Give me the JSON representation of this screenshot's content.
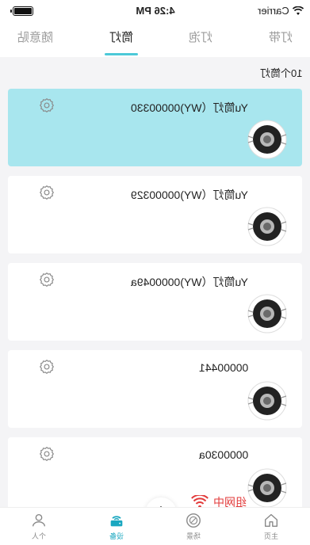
{
  "status_bar": {
    "carrier": "Carrier",
    "time": "4:26 PM",
    "battery_level": 1.0
  },
  "tabs": [
    {
      "label": "灯带",
      "active": false
    },
    {
      "label": "灯泡",
      "active": false
    },
    {
      "label": "筒灯",
      "active": true
    },
    {
      "label": "随意贴",
      "active": false
    }
  ],
  "device_count": "10个筒灯",
  "devices": [
    {
      "name": "Yu筒灯（WY)00000330",
      "selected": true
    },
    {
      "name": "Yu筒灯（WY)00000329",
      "selected": false
    },
    {
      "name": "Yu筒灯（WY)0000049a",
      "selected": false
    },
    {
      "name": "00000441",
      "selected": false
    },
    {
      "name": "0000030a",
      "selected": false,
      "status": "组网中"
    }
  ],
  "bottom_nav": [
    {
      "label": "主页",
      "icon": "home-icon",
      "active": false
    },
    {
      "label": "场景",
      "icon": "scene-icon",
      "active": false
    },
    {
      "label": "设备",
      "icon": "device-icon",
      "active": true
    },
    {
      "label": "个人",
      "icon": "person-icon",
      "active": false
    }
  ],
  "fab_icon": "plus-icon",
  "colors": {
    "accent": "#4cc9d8",
    "selected_card": "#a8e6ee",
    "status_red": "#e23a3a",
    "nav_active": "#1aa7c0"
  }
}
